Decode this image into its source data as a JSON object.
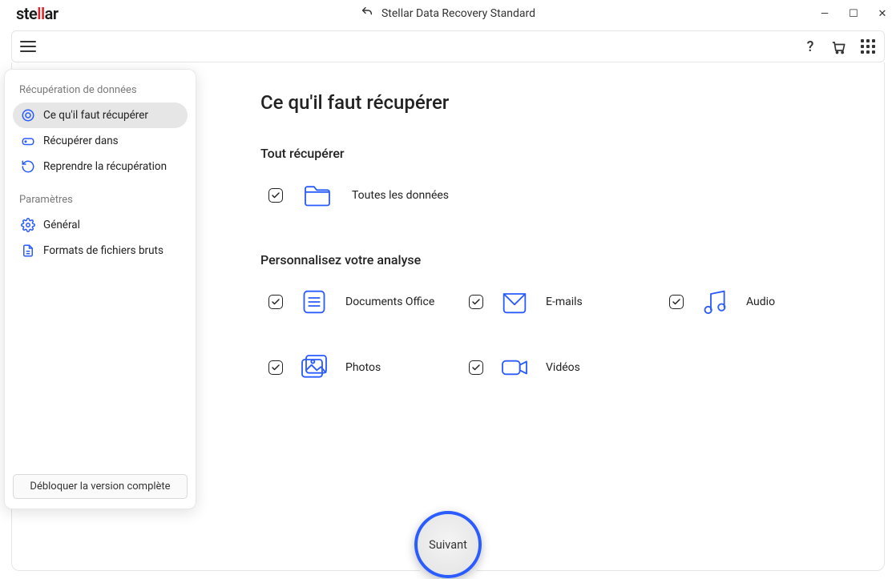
{
  "logo": {
    "part1": "ste",
    "part2": "ll",
    "part3": "ar"
  },
  "window_title": "Stellar Data Recovery Standard",
  "sidebar": {
    "section_recovery": "Récupération de données",
    "items_recovery": [
      {
        "label": "Ce qu'il faut récupérer"
      },
      {
        "label": "Récupérer dans"
      },
      {
        "label": "Reprendre la récupération"
      }
    ],
    "section_settings": "Paramètres",
    "items_settings": [
      {
        "label": "Général"
      },
      {
        "label": "Formats de fichiers bruts"
      }
    ],
    "unlock": "Débloquer la version complète"
  },
  "page": {
    "title": "Ce qu'il faut récupérer",
    "all_heading": "Tout récupérer",
    "all_option": "Toutes les données",
    "custom_heading": "Personnalisez votre analyse",
    "options": [
      {
        "label": "Documents Office"
      },
      {
        "label": "E-mails"
      },
      {
        "label": "Audio"
      },
      {
        "label": "Photos"
      },
      {
        "label": "Vidéos"
      }
    ],
    "next": "Suivant"
  }
}
